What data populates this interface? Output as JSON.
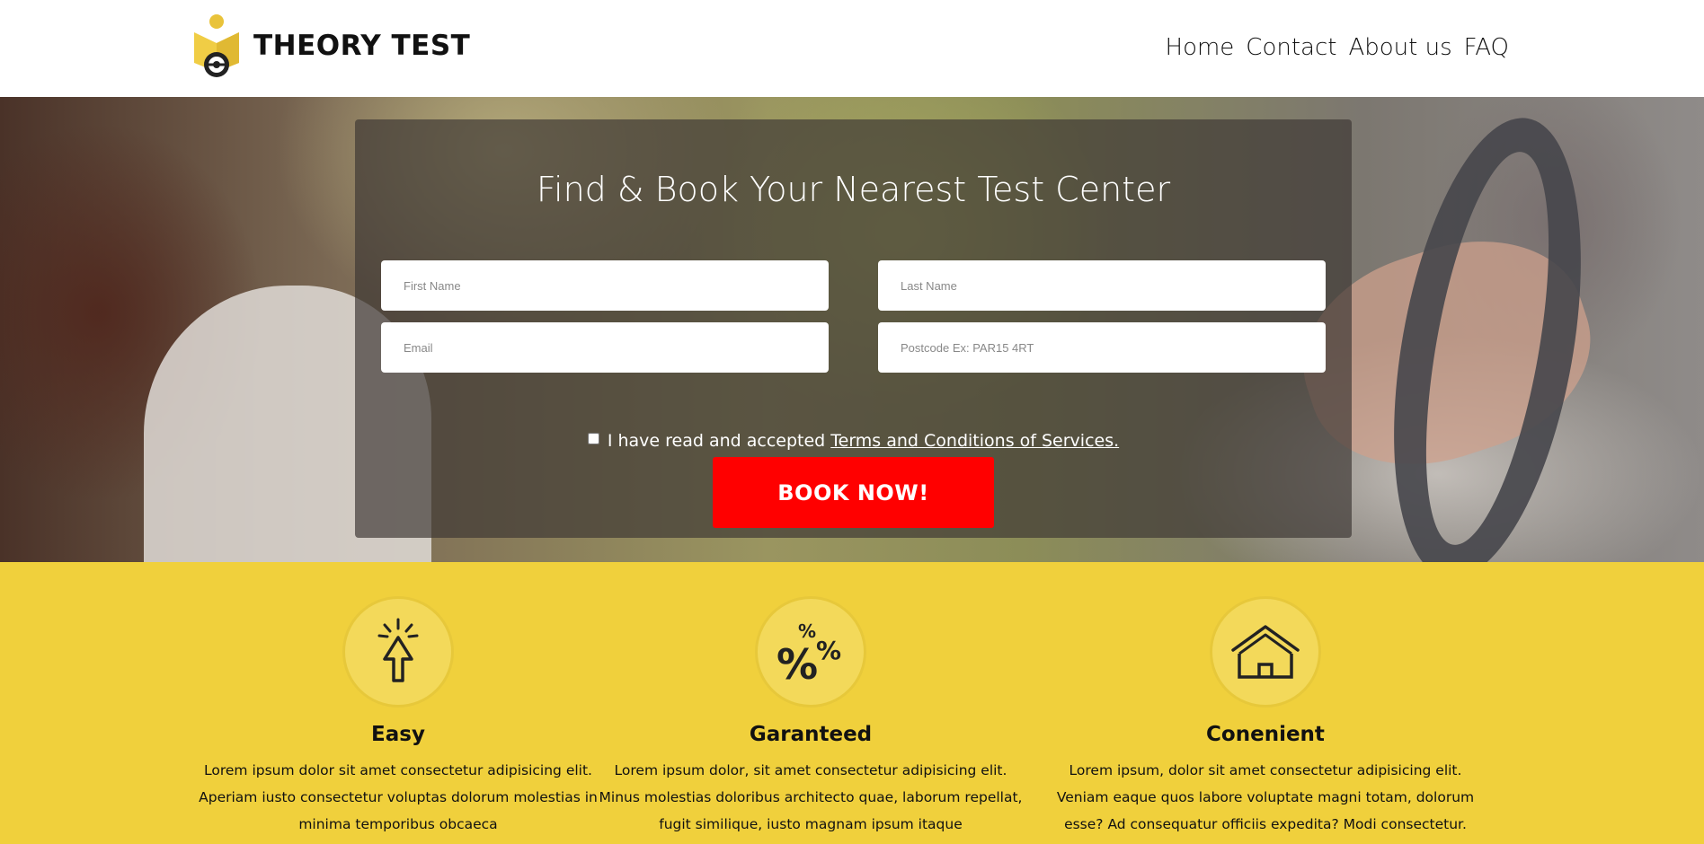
{
  "brand": {
    "name": "THEORY TEST",
    "logo_icon": "driving-student-logo"
  },
  "nav": {
    "items": [
      "Home",
      "Contact",
      "About us",
      "FAQ"
    ]
  },
  "hero": {
    "title": "Find & Book Your Nearest Test Center",
    "form": {
      "first_name_placeholder": "First Name",
      "last_name_placeholder": "Last Name",
      "email_placeholder": "Email",
      "postcode_placeholder": "Postcode Ex: PAR15 4RT"
    },
    "terms_text": "I have read and accepted",
    "terms_link": "Terms and Conditions of Services.",
    "book_button": "BOOK NOW!"
  },
  "features": [
    {
      "icon": "cursor-click-icon",
      "title": "Easy",
      "text": "Lorem ipsum dolor sit amet consectetur adipisicing elit. Aperiam iusto consectetur voluptas dolorum molestias in minima temporibus obcaeca"
    },
    {
      "icon": "percent-icon",
      "title": "Garanteed",
      "text": "Lorem ipsum dolor, sit amet consectetur adipisicing elit. Minus molestias doloribus architecto quae, laborum repellat, fugit similique, iusto magnam ipsum itaque"
    },
    {
      "icon": "house-icon",
      "title": "Conenient",
      "text": "Lorem ipsum, dolor sit amet consectetur adipisicing elit. Veniam eaque quos labore voluptate magni totam, dolorum esse? Ad consequatur officiis expedita? Modi consectetur."
    }
  ],
  "colors": {
    "accent_yellow": "#f0d03c",
    "button_red": "#ff0000"
  }
}
